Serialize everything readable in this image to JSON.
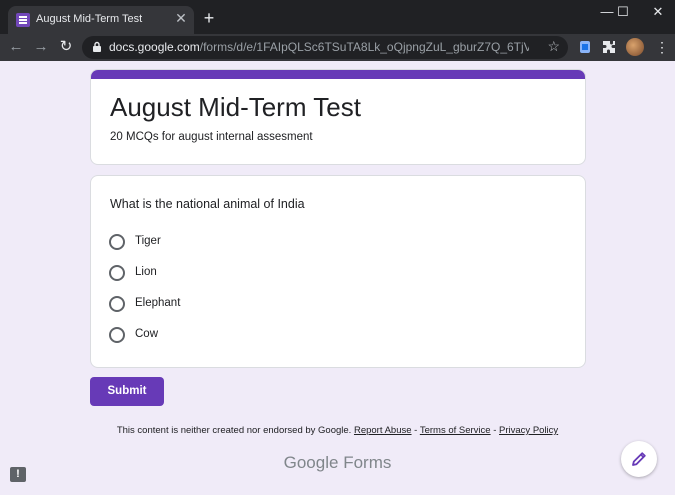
{
  "browser": {
    "tab_title": "August Mid-Term Test",
    "tab_close": "✕",
    "new_tab": "+",
    "window_minimize": "—",
    "window_maximize": "☐",
    "window_close": "✕",
    "back": "←",
    "forward": "→",
    "reload": "↻",
    "url_host": "docs.google.com",
    "url_path": "/forms/d/e/1FAIpQLSc6TSuTA8Lk_oQjpngZuL_gburZ7Q_6TjVmTSMeV...",
    "bookmark_star": "☆",
    "menu_dots": "⋮",
    "icons": [
      "tab-forms-icon",
      "lock-icon",
      "extension-icon",
      "puzzle-icon",
      "profile-avatar"
    ]
  },
  "form": {
    "title": "August Mid-Term Test",
    "description": "20 MCQs for august internal assesment",
    "accent_color": "#673ab7",
    "background_color": "#f0ebf8",
    "question": {
      "text": "What is the national animal of India",
      "options": [
        "Tiger",
        "Lion",
        "Elephant",
        "Cow"
      ]
    },
    "submit_label": "Submit"
  },
  "footer": {
    "note": "This content is neither created nor endorsed by Google.",
    "report_abuse": "Report Abuse",
    "sep1": " - ",
    "terms": "Terms of Service",
    "sep2": " - ",
    "privacy": "Privacy Policy",
    "brand_google": "Google",
    "brand_forms": "Forms",
    "report_icon": "!"
  }
}
